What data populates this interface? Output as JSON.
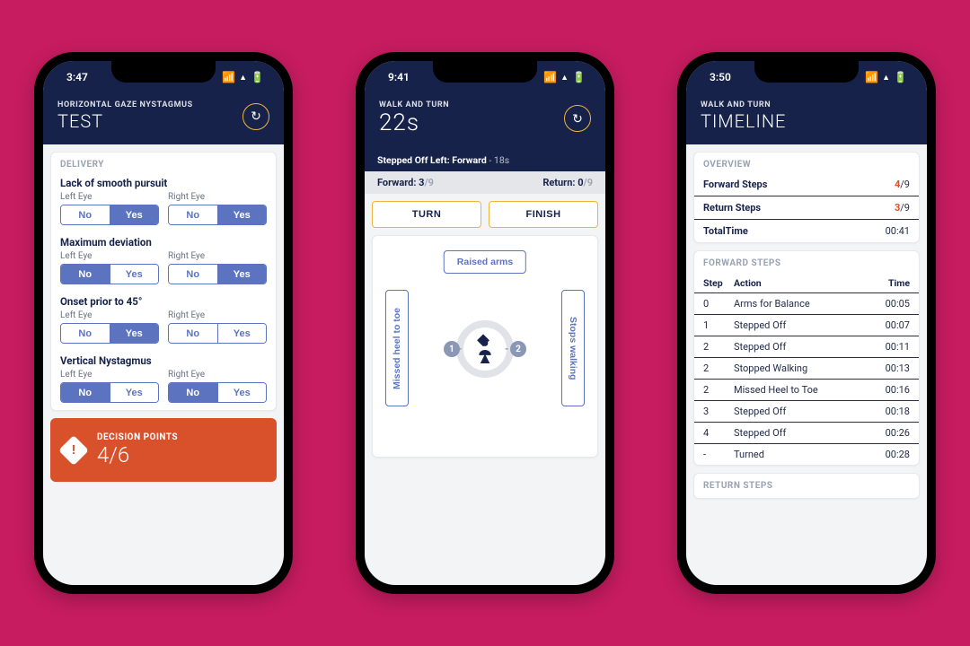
{
  "status": {
    "signal": "▮▮▮▮",
    "wifi": "⬤",
    "battery": "▮"
  },
  "phone1": {
    "time": "3:47",
    "eyebrow": "HORIZONTAL GAZE NYSTAGMUS",
    "title": "TEST",
    "section_label": "DELIVERY",
    "no_label": "No",
    "yes_label": "Yes",
    "left_eye_label": "Left Eye",
    "right_eye_label": "Right Eye",
    "groups": [
      {
        "title": "Lack of smooth pursuit",
        "left": "Yes",
        "right": "Yes"
      },
      {
        "title": "Maximum deviation",
        "left": "No",
        "right": "Yes"
      },
      {
        "title": "Onset prior to 45°",
        "left": "Yes",
        "right": null
      },
      {
        "title": "Vertical Nystagmus",
        "left": "No",
        "right": "No"
      }
    ],
    "decision_label": "DECISION POINTS",
    "decision_value": "4/6"
  },
  "phone2": {
    "time": "9:41",
    "eyebrow": "WALK AND TURN",
    "timer": "22s",
    "event_text": "Stepped Off Left: Forward",
    "event_time": "- 18s",
    "forward_label": "Forward:",
    "forward_value": "3",
    "forward_total": "/9",
    "return_label": "Return:",
    "return_value": "0",
    "return_total": "/9",
    "turn_btn": "TURN",
    "finish_btn": "FINISH",
    "raised_arms": "Raised arms",
    "missed": "Missed heel to toe",
    "stops": "Stops walking",
    "chip1": "1",
    "chip2": "2"
  },
  "phone3": {
    "time": "3:50",
    "eyebrow": "WALK AND TURN",
    "title": "TIMELINE",
    "overview_label": "OVERVIEW",
    "forward_steps_label": "Forward Steps",
    "forward_steps_value": "4",
    "forward_steps_total": "/9",
    "return_steps_label": "Return Steps",
    "return_steps_value": "3",
    "return_steps_total": "/9",
    "total_time_label": "TotalTime",
    "total_time_value": "00:41",
    "fwd_section": "FORWARD STEPS",
    "ret_section": "RETURN STEPS",
    "col_step": "Step",
    "col_action": "Action",
    "col_time": "Time",
    "forward_rows": [
      {
        "step": "0",
        "action": "Arms for Balance",
        "time": "00:05"
      },
      {
        "step": "1",
        "action": "Stepped Off",
        "time": "00:07"
      },
      {
        "step": "2",
        "action": "Stepped Off",
        "time": "00:11"
      },
      {
        "step": "2",
        "action": "Stopped Walking",
        "time": "00:13"
      },
      {
        "step": "2",
        "action": "Missed Heel to Toe",
        "time": "00:16"
      },
      {
        "step": "3",
        "action": "Stepped Off",
        "time": "00:18"
      },
      {
        "step": "4",
        "action": "Stepped Off",
        "time": "00:26"
      },
      {
        "step": "-",
        "action": "Turned",
        "time": "00:28"
      }
    ]
  }
}
